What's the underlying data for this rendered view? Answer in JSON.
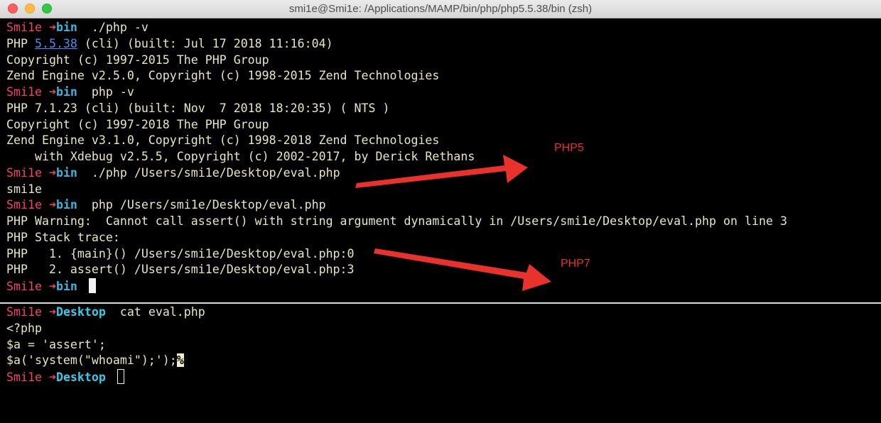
{
  "window": {
    "title": "smi1e@Smi1e: /Applications/MAMP/bin/php/php5.5.38/bin (zsh)"
  },
  "prompt": {
    "user": "Smi1e",
    "arrow": "➜",
    "dir_bin": "bin",
    "dir_desktop": "Desktop"
  },
  "top_pane": {
    "cmd1": " ./php -v",
    "php5_ver_prefix": "PHP ",
    "php5_ver": "5.5.38",
    "php5_ver_suffix": " (cli) (built: Jul 17 2018 11:16:04)",
    "php5_copyright": "Copyright (c) 1997-2015 The PHP Group",
    "php5_zend": "Zend Engine v2.5.0, Copyright (c) 1998-2015 Zend Technologies",
    "cmd2": " php -v",
    "php7_ver": "PHP 7.1.23 (cli) (built: Nov  7 2018 18:20:35) ( NTS )",
    "php7_copyright": "Copyright (c) 1997-2018 The PHP Group",
    "php7_zend": "Zend Engine v3.1.0, Copyright (c) 1998-2018 Zend Technologies",
    "php7_xdebug": "    with Xdebug v2.5.5, Copyright (c) 2002-2017, by Derick Rethans",
    "cmd3": " ./php /Users/smi1e/Desktop/eval.php",
    "out3": "smi1e",
    "cmd4": " php /Users/smi1e/Desktop/eval.php",
    "warning": "PHP Warning:  Cannot call assert() with string argument dynamically in /Users/smi1e/Desktop/eval.php on line 3",
    "stack": "PHP Stack trace:",
    "stack1": "PHP   1. {main}() /Users/smi1e/Desktop/eval.php:0",
    "stack2": "PHP   2. assert() /Users/smi1e/Desktop/eval.php:3"
  },
  "bottom_pane": {
    "cmd1": " cat eval.php",
    "code1": "<?php",
    "code2": "$a = 'assert';",
    "code3": "$a('system(\"whoami\");');",
    "percent": "%"
  },
  "annotations": {
    "php5_label": "PHP5",
    "php7_label": "PHP7",
    "color": "#e8322b"
  }
}
